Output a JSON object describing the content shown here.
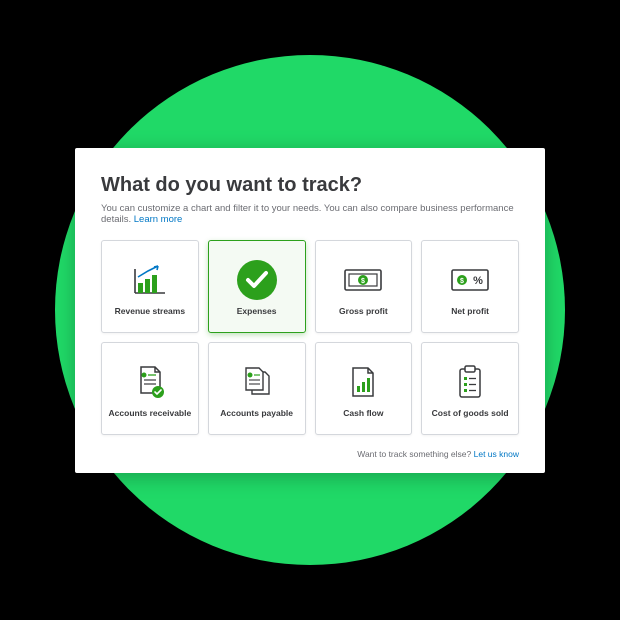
{
  "colors": {
    "accent_green": "#2ca01c",
    "bg_circle": "#20d967",
    "link_blue": "#0077c5",
    "text_dark": "#393a3d",
    "text_muted": "#6b6c72"
  },
  "heading": "What do you want to track?",
  "subtext": "You can customize a chart and filter it to your needs. You can also compare business performance details. ",
  "learn_more": "Learn more",
  "cards": [
    {
      "label": "Revenue streams",
      "icon": "bar-chart-growth-icon",
      "selected": false
    },
    {
      "label": "Expenses",
      "icon": "checkmark-circle-icon",
      "selected": true
    },
    {
      "label": "Gross profit",
      "icon": "money-bill-icon",
      "selected": false
    },
    {
      "label": "Net profit",
      "icon": "money-bill-percent-icon",
      "selected": false
    },
    {
      "label": "Accounts receivable",
      "icon": "document-check-icon",
      "selected": false
    },
    {
      "label": "Accounts payable",
      "icon": "documents-stack-icon",
      "selected": false
    },
    {
      "label": "Cash flow",
      "icon": "document-chart-icon",
      "selected": false
    },
    {
      "label": "Cost of goods sold",
      "icon": "clipboard-list-icon",
      "selected": false
    }
  ],
  "footer_prompt": "Want to track something else? ",
  "footer_link": "Let us know"
}
